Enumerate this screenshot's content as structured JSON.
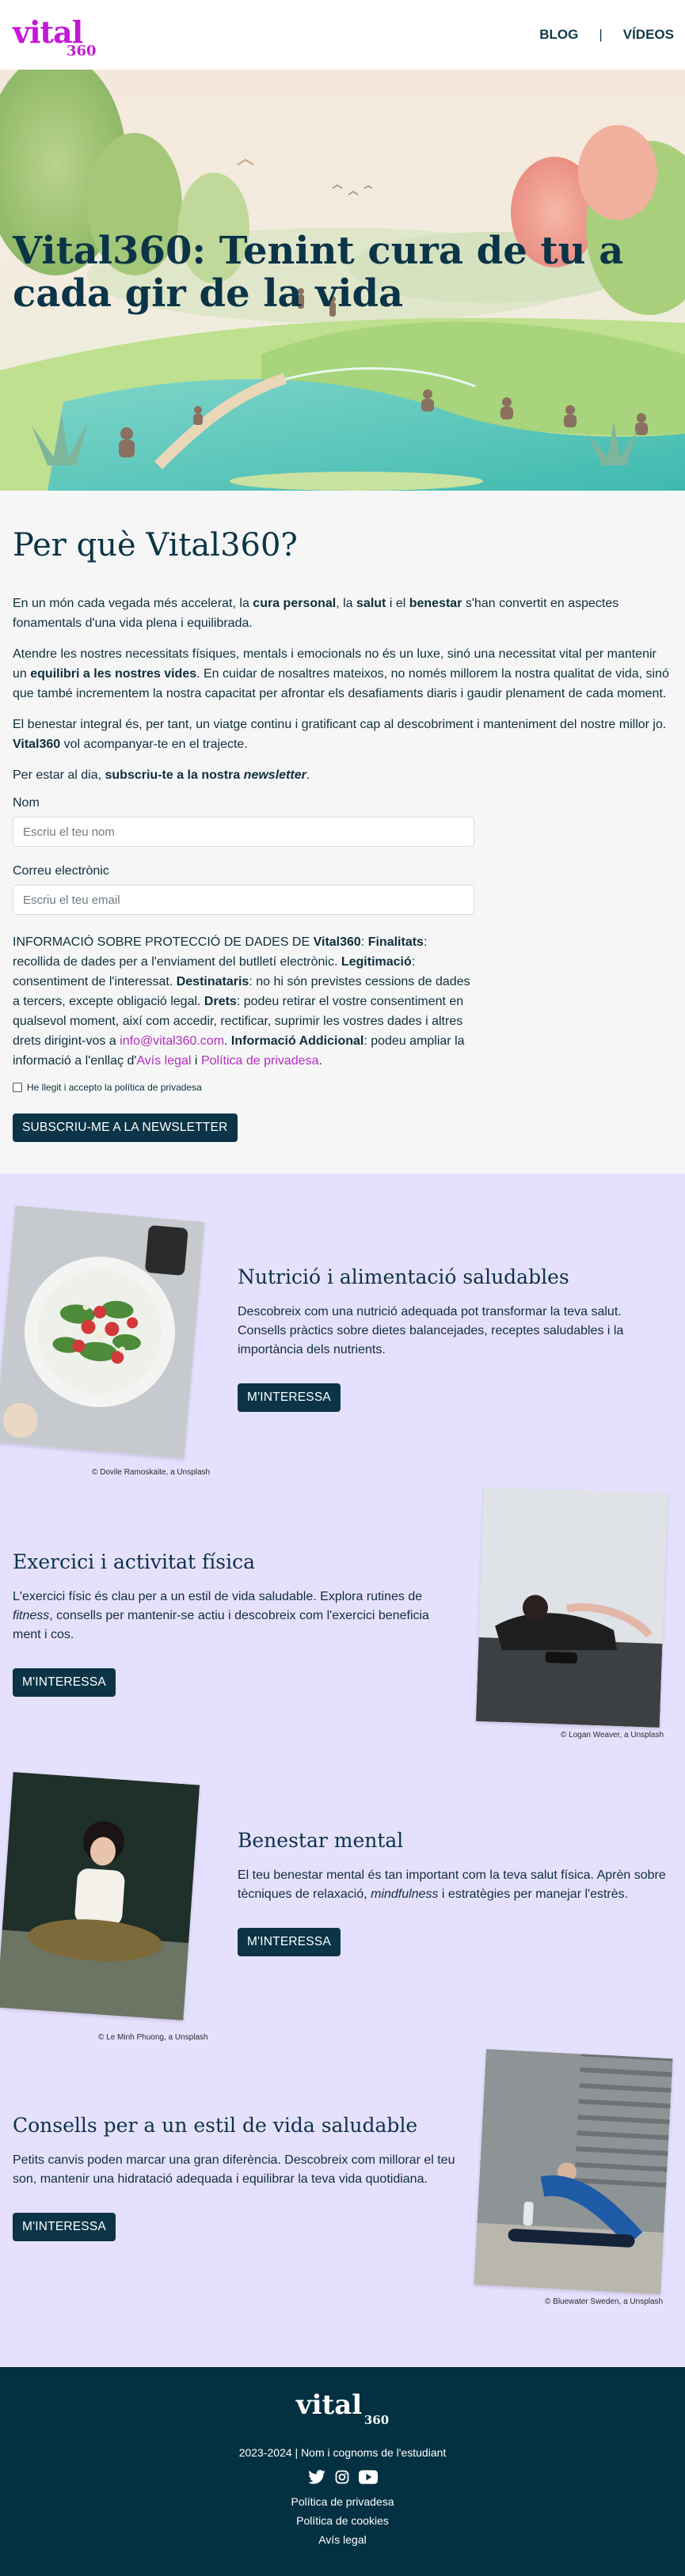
{
  "header": {
    "logo_word": "vital",
    "logo_num": "360",
    "nav": [
      "BLOG",
      "|",
      "VÍDEOS"
    ]
  },
  "hero": {
    "title": "Vital360: Tenint cura de tu a cada gir de la vida"
  },
  "why": {
    "title": "Per què Vital360?",
    "p1": [
      "En un món cada vegada més accelerat, la ",
      "cura personal",
      ", la ",
      "salut",
      " i el ",
      "benestar",
      " s'han convertit en aspectes fonamentals d'una vida plena i equilibrada."
    ],
    "p2": [
      "Atendre les nostres necessitats físiques, mentals i emocionals no és un luxe, sinó una necessitat vital per mantenir un ",
      "equilibri a les nostres vides",
      ". En cuidar de nosaltres mateixos, no només millorem la nostra qualitat de vida, sinó que també incrementem la nostra capacitat per afrontar els desafiaments diaris i gaudir plenament de cada moment."
    ],
    "p3": [
      "El benestar integral és, per tant, un viatge continu i gratificant cap al descobriment i manteniment del nostre millor jo. ",
      "Vital360",
      " vol acompanyar-te en el trajecte."
    ],
    "p4": [
      "Per estar al dia, ",
      "subscriu-te a la nostra ",
      "newsletter",
      "."
    ],
    "form": {
      "name_label": "Nom",
      "name_placeholder": "Escriu el teu nom",
      "email_label": "Correu electrònic",
      "email_placeholder": "Escriu el teu email",
      "legal": [
        "INFORMACIÓ SOBRE PROTECCIÓ DE DADES DE ",
        "Vital360",
        ": ",
        "Finalitats",
        ": recollida de dades per a l'enviament del butlletí electrònic. ",
        "Legitimació",
        ": consentiment de l'interessat. ",
        "Destinataris",
        ": no hi són previstes cessions de dades a tercers, excepte obligació legal. ",
        "Drets",
        ": podeu retirar el vostre consentiment en qualsevol moment, així com accedir, rectificar, suprimir les vostres dades i altres drets dirigint-vos a ",
        "info@vital360.com",
        ". ",
        "Informació Addicional",
        ": podeu ampliar la informació a l'enllaç d'",
        "Avís legal",
        " i ",
        "Política de privadesa",
        "."
      ],
      "checkbox_label": "He llegit i accepto la política de privadesa",
      "submit": "SUBSCRIU-ME A LA NEWSLETTER"
    }
  },
  "topics": [
    {
      "title": "Nutrició i alimentació saludables",
      "text": "Descobreix com una nutrició adequada pot transformar la teva salut. Consells pràctics sobre dietes balancejades, receptes saludables i la importància dels nutrients.",
      "button": "M'INTERESSA",
      "credit": "© Dovile Ramoskaite, a Unsplash"
    },
    {
      "title": "Exercici i activitat física",
      "text_parts": [
        "L'exercici físic és clau per a un estil de vida saludable. Explora rutines de ",
        "fitness",
        ", consells per mantenir-se actiu i descobreix com l'exercici beneficia ment i cos."
      ],
      "button": "M'INTERESSA",
      "credit": "© Logan Weaver, a Unsplash"
    },
    {
      "title": "Benestar mental",
      "text_parts": [
        "El teu benestar mental és tan important com la teva salut física. Aprèn sobre tècniques de relaxació, ",
        "mindfulness",
        " i estratègies per manejar l'estrès."
      ],
      "button": "M'INTERESSA",
      "credit": "© Le Minh Phuong, a Unsplash"
    },
    {
      "title": "Consells per a un estil de vida saludable",
      "text": "Petits canvis poden marcar una gran diferència. Descobreix com millorar el teu son, mantenir una hidratació adequada i equilibrar la teva vida quotidiana.",
      "button": "M'INTERESSA",
      "credit": "© Bluewater Sweden, a Unsplash"
    }
  ],
  "footer": {
    "logo_word": "vital",
    "logo_num": "360",
    "copyright": "2023-2024 | Nom i cognoms de l'estudiant",
    "social_icons": [
      "twitter-icon",
      "instagram-icon",
      "youtube-icon"
    ],
    "links": [
      "Política de privadesa",
      "Política de cookies",
      "Avís legal"
    ]
  },
  "colors": {
    "brand": "#c418d6",
    "dark": "#0b3447",
    "lavender": "#e6e0ff",
    "footer": "#043142"
  }
}
